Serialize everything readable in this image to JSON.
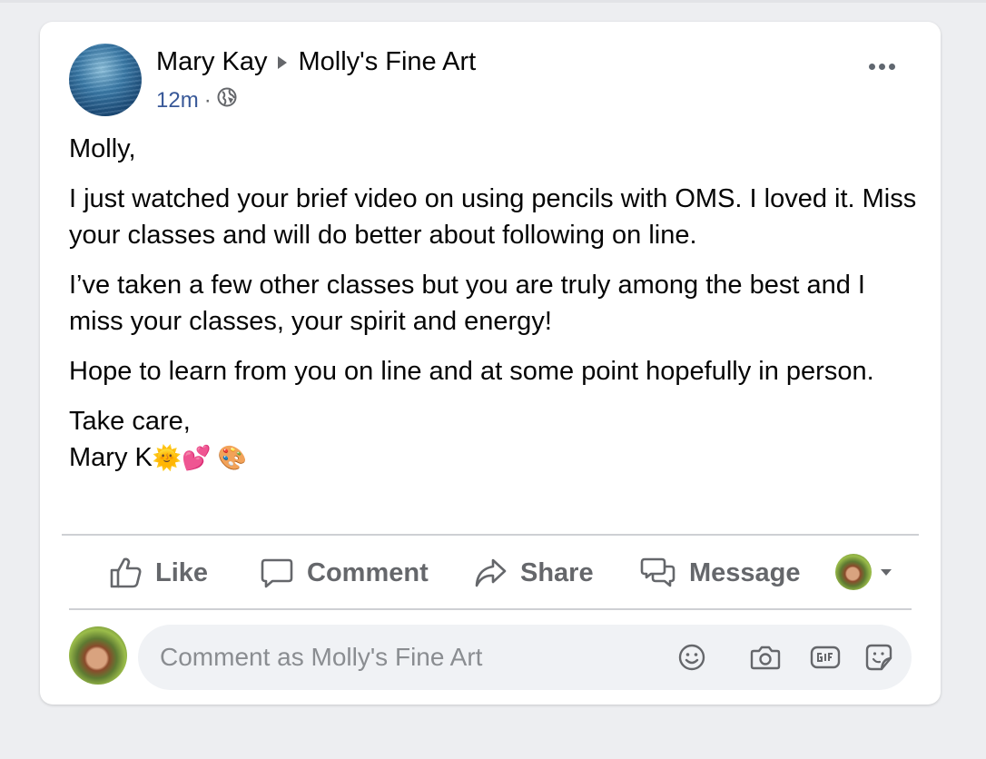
{
  "post": {
    "author": "Mary Kay",
    "target_page": "Molly's Fine Art",
    "time": "12m",
    "separator": "·",
    "privacy_icon": "globe-icon",
    "more_icon": "more-options-icon",
    "greeting": "Molly,",
    "paragraph_1": "I just watched your brief video on using pencils with OMS. I loved it. Miss your classes and will do better about following on line.",
    "paragraph_2": "I’ve taken a few other classes but you are truly among the best and I miss your classes, your spirit and energy!",
    "paragraph_3": "Hope to learn from you on line and at some point hopefully in person.",
    "closing": "Take care,",
    "signature": "Mary K",
    "signature_emojis": "🌞💕 🎨"
  },
  "actions": {
    "like": "Like",
    "comment": "Comment",
    "share": "Share",
    "message": "Message"
  },
  "composer": {
    "placeholder": "Comment as Molly's Fine Art",
    "icons": [
      "emoji-icon",
      "camera-icon",
      "gif-icon",
      "sticker-icon"
    ]
  },
  "colors": {
    "background": "#edeef1",
    "card": "#ffffff",
    "meta_link": "#385898",
    "action_gray": "#65676b",
    "input_bg": "#f0f2f5"
  }
}
